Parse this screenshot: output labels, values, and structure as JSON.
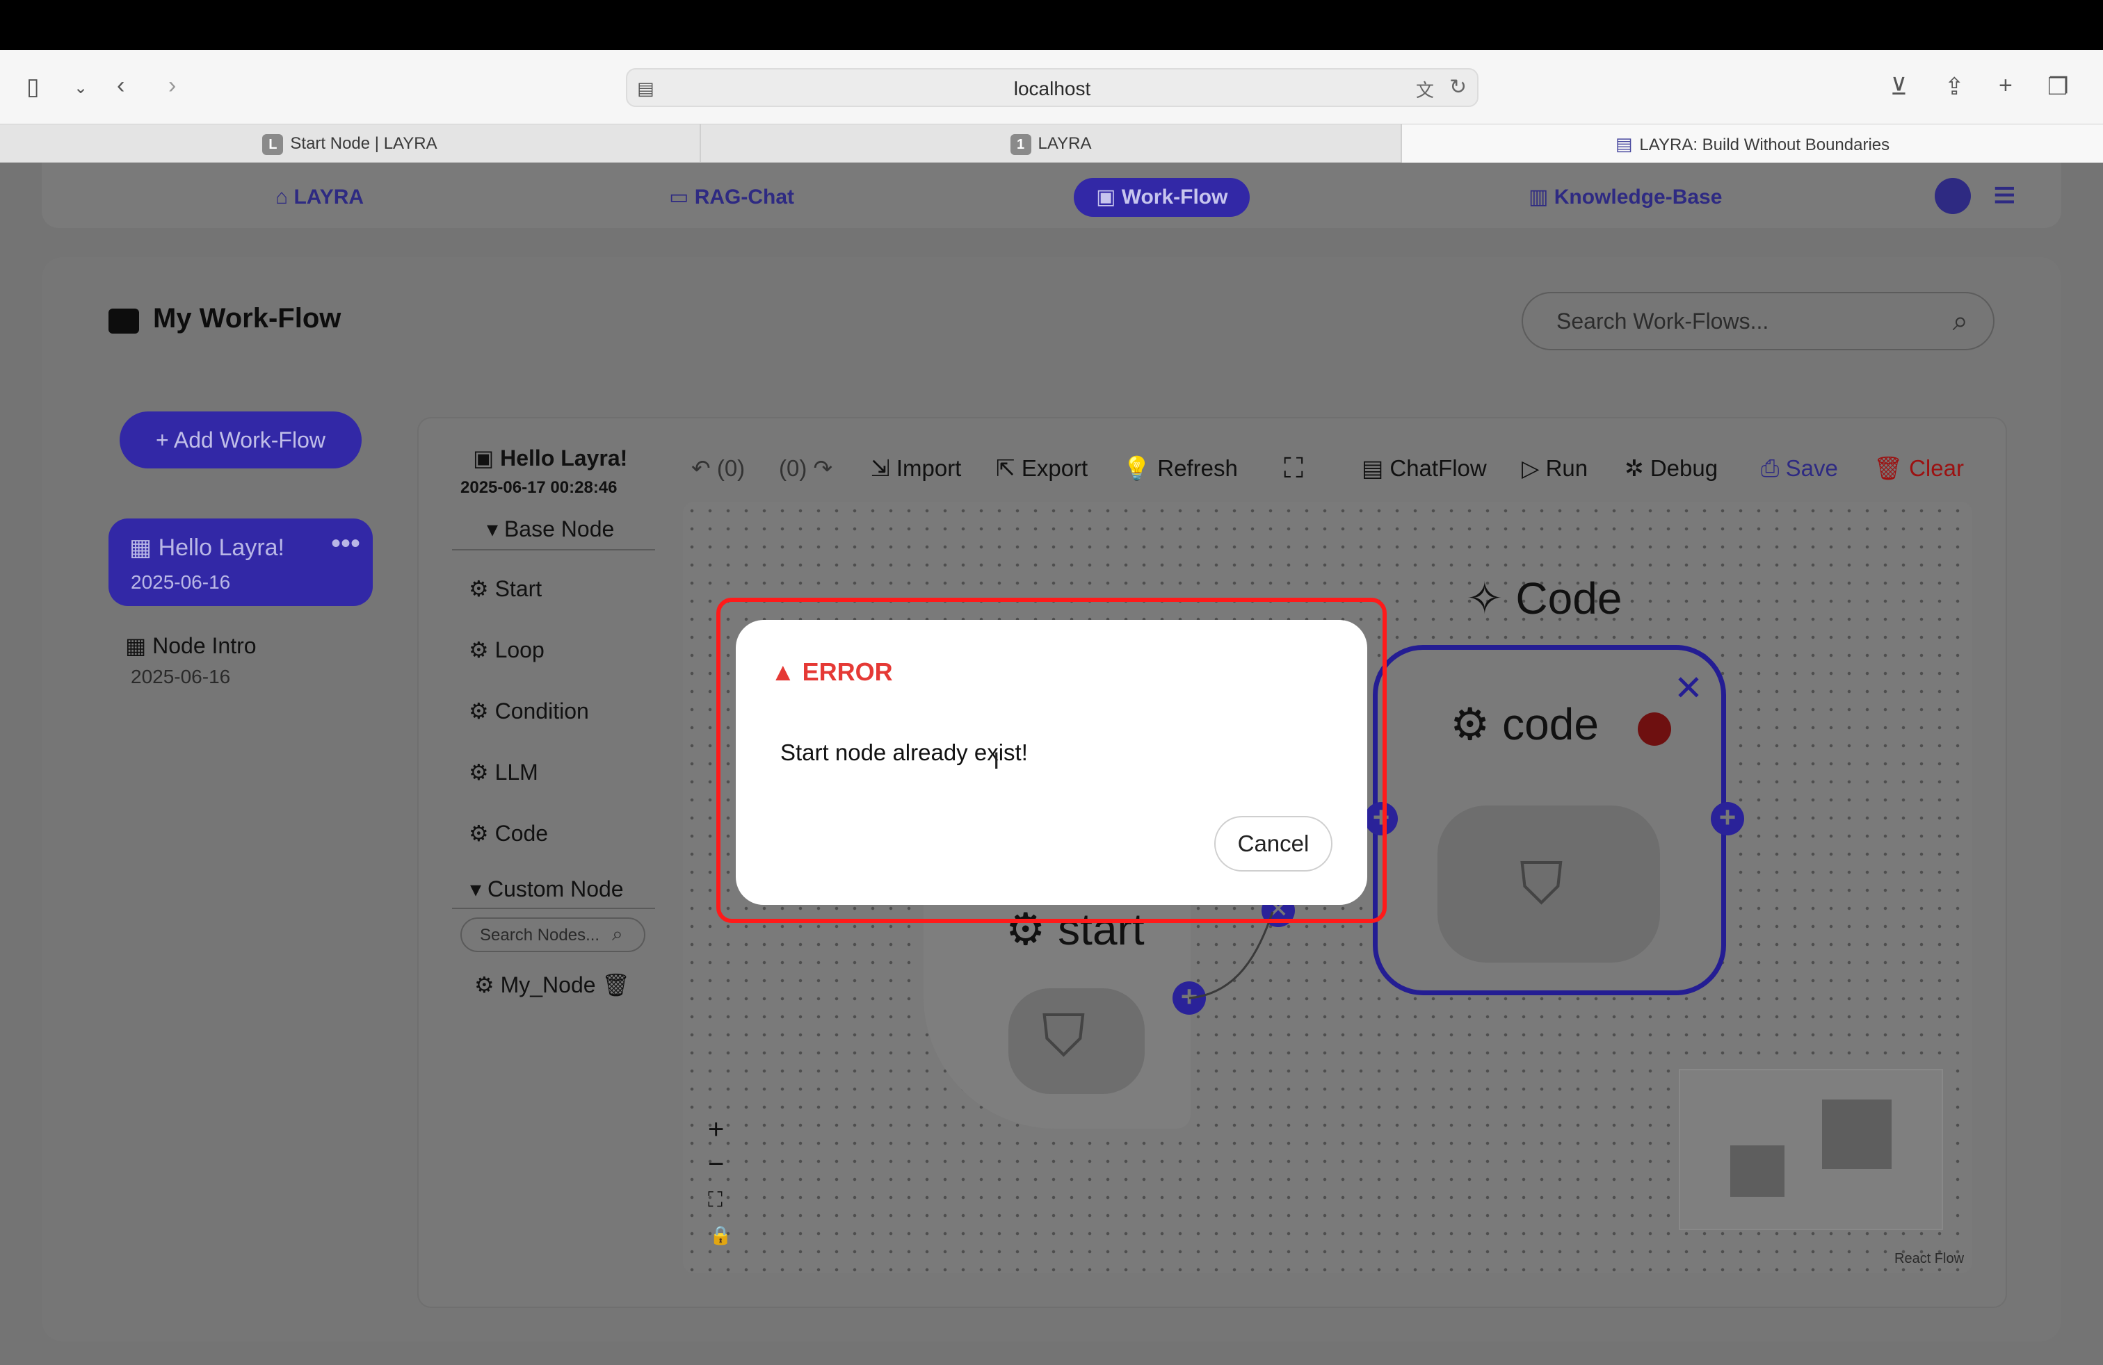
{
  "browser": {
    "url": "localhost",
    "tabs": [
      {
        "favicon": "L",
        "title": "Start Node | LAYRA"
      },
      {
        "favicon": "1",
        "title": "LAYRA"
      },
      {
        "favicon": "doc-icon",
        "title": "LAYRA: Build Without Boundaries"
      }
    ]
  },
  "nav": {
    "items": [
      "LAYRA",
      "RAG-Chat",
      "Work-Flow",
      "Knowledge-Base"
    ],
    "active": "Work-Flow"
  },
  "page": {
    "title": "My Work-Flow",
    "search_placeholder": "Search Work-Flows...",
    "add_button": "+ Add Work-Flow"
  },
  "workflows": [
    {
      "title": "Hello Layra!",
      "date": "2025-06-16",
      "active": true
    },
    {
      "title": "Node Intro",
      "date": "2025-06-16",
      "active": false
    }
  ],
  "editor": {
    "workflow_title": "Hello Layra!",
    "workflow_timestamp": "2025-06-17 00:28:46",
    "base_node_header": "Base Node",
    "base_nodes": [
      "Start",
      "Loop",
      "Condition",
      "LLM",
      "Code"
    ],
    "custom_node_header": "Custom Node",
    "search_nodes_placeholder": "Search Nodes...",
    "custom_nodes": [
      "My_Node"
    ],
    "toolbar": {
      "undo": "(0)",
      "redo": "(0)",
      "import": "Import",
      "export": "Export",
      "refresh": "Refresh",
      "chatflow": "ChatFlow",
      "run": "Run",
      "debug": "Debug",
      "save": "Save",
      "clear": "Clear"
    },
    "canvas": {
      "code_label": "Code",
      "code_node_name": "code",
      "start_node_name": "start",
      "attribution": "React Flow"
    }
  },
  "dialog": {
    "title": "ERROR",
    "message": "Start node already exist!",
    "cancel": "Cancel"
  },
  "colors": {
    "brand": "#3228a6",
    "error": "#e53935",
    "status_dot": "#c31a1a",
    "highlight": "#ff1a1a"
  }
}
